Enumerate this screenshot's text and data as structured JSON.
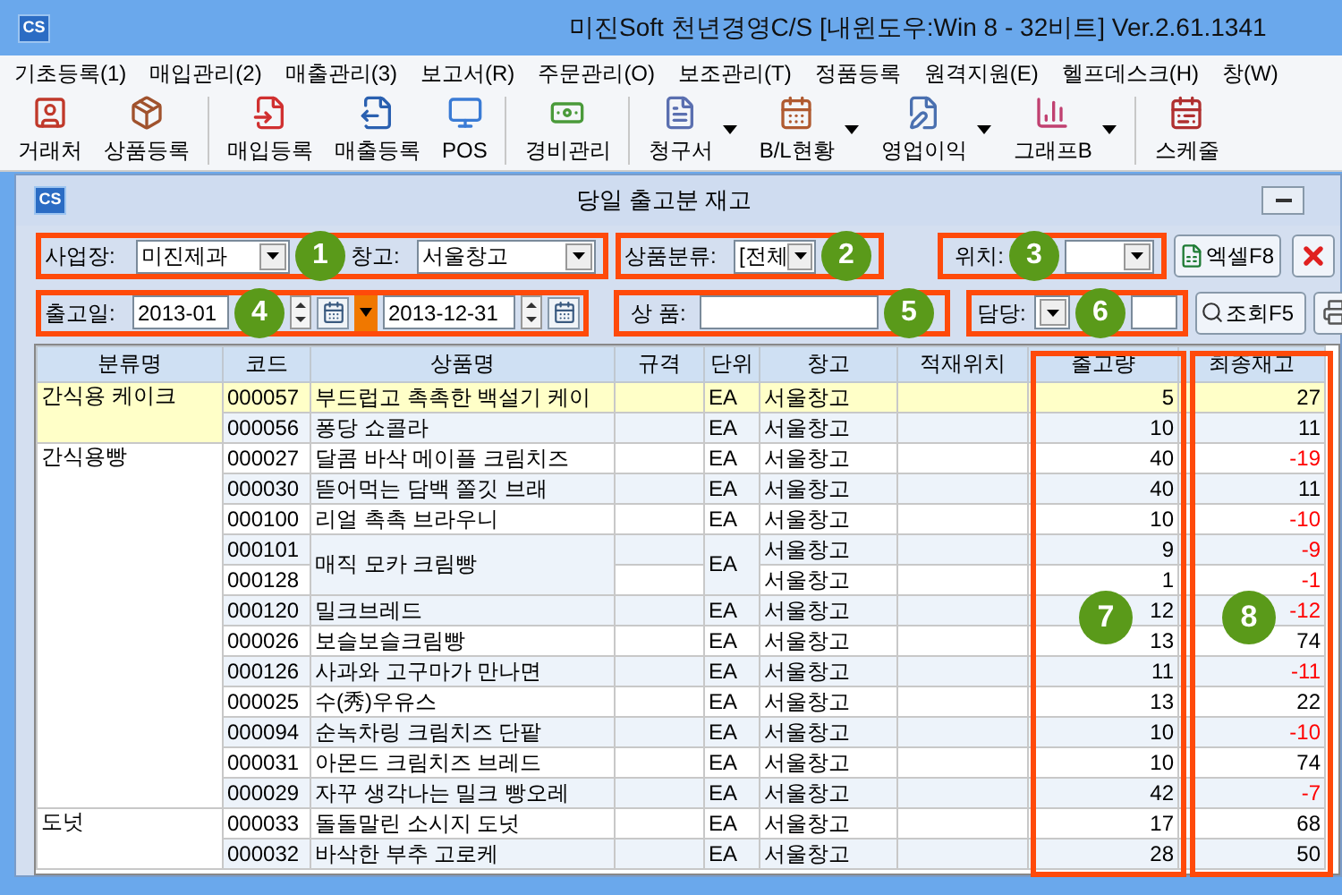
{
  "window": {
    "title": "미진Soft 천년경영C/S [내윈도우:Win 8 - 32비트] Ver.2.61.1341",
    "logo": "CS"
  },
  "menu": [
    "기초등록(1)",
    "매입관리(2)",
    "매출관리(3)",
    "보고서(R)",
    "주문관리(O)",
    "보조관리(T)",
    "정품등록",
    "원격지원(E)",
    "헬프데스크(H)",
    "창(W)"
  ],
  "toolbar": [
    {
      "label": "거래처",
      "kind": "contact",
      "dropdown": false,
      "group_start": false
    },
    {
      "label": "상품등록",
      "kind": "box",
      "dropdown": false,
      "group_start": false
    },
    {
      "label": "매입등록",
      "kind": "in",
      "dropdown": false,
      "group_start": true
    },
    {
      "label": "매출등록",
      "kind": "out",
      "dropdown": false,
      "group_start": false
    },
    {
      "label": "POS",
      "kind": "pos",
      "dropdown": false,
      "group_start": false
    },
    {
      "label": "경비관리",
      "kind": "money",
      "dropdown": false,
      "group_start": true
    },
    {
      "label": "청구서",
      "kind": "invoice",
      "dropdown": true,
      "group_start": true
    },
    {
      "label": "B/L현황",
      "kind": "calendar",
      "dropdown": true,
      "group_start": false
    },
    {
      "label": "영업이익",
      "kind": "edit",
      "dropdown": true,
      "group_start": false
    },
    {
      "label": "그래프B",
      "kind": "chart",
      "dropdown": true,
      "group_start": false
    },
    {
      "label": "스케줄",
      "kind": "schedule",
      "dropdown": false,
      "group_start": true
    }
  ],
  "child_window": {
    "title": "당일 출고분 재고",
    "logo": "CS"
  },
  "filters": {
    "site_label": "사업장:",
    "site_value": "미진제과",
    "warehouse_label": "창고:",
    "warehouse_value": "서울창고",
    "category_label": "상품분류:",
    "category_value": "[전체",
    "location_label": "위치:",
    "excel_button": "엑셀F8",
    "date_label": "출고일:",
    "date_from": "2013-01",
    "date_to": "2013-12-31",
    "product_label": "상 품:",
    "manager_label": "담당:",
    "search_button": "조회F5"
  },
  "annotations": [
    "1",
    "2",
    "3",
    "4",
    "5",
    "6",
    "7",
    "8"
  ],
  "table": {
    "columns": [
      "분류명",
      "코드",
      "상품명",
      "규격",
      "단위",
      "창고",
      "적재위치",
      "출고량",
      "최종재고"
    ],
    "categories": [
      {
        "name": "간식용 케이크",
        "products": [
          {
            "name": "부드럽고 촉촉한 백설기 케이",
            "unit": "EA",
            "lines": [
              {
                "code": "000057",
                "warehouse": "서울창고",
                "qty": "5",
                "stock": "27",
                "negative": false,
                "selected": true
              }
            ]
          },
          {
            "name": "퐁당 쇼콜라",
            "unit": "EA",
            "lines": [
              {
                "code": "000056",
                "warehouse": "서울창고",
                "qty": "10",
                "stock": "11",
                "negative": false,
                "selected": false
              }
            ]
          }
        ]
      },
      {
        "name": "간식용빵",
        "products": [
          {
            "name": "달콤 바삭 메이플 크림치즈",
            "unit": "EA",
            "lines": [
              {
                "code": "000027",
                "warehouse": "서울창고",
                "qty": "40",
                "stock": "-19",
                "negative": true,
                "selected": false
              }
            ]
          },
          {
            "name": "뜯어먹는 담백 쫄깃 브래",
            "unit": "EA",
            "lines": [
              {
                "code": "000030",
                "warehouse": "서울창고",
                "qty": "40",
                "stock": "11",
                "negative": false,
                "selected": false
              }
            ]
          },
          {
            "name": "리얼 촉촉 브라우니",
            "unit": "EA",
            "lines": [
              {
                "code": "000100",
                "warehouse": "서울창고",
                "qty": "10",
                "stock": "-10",
                "negative": true,
                "selected": false
              }
            ]
          },
          {
            "name": "매직 모카 크림빵",
            "unit": "EA",
            "lines": [
              {
                "code": "000101",
                "warehouse": "서울창고",
                "qty": "9",
                "stock": "-9",
                "negative": true,
                "selected": false
              },
              {
                "code": "000128",
                "warehouse": "서울창고",
                "qty": "1",
                "stock": "-1",
                "negative": true,
                "selected": false
              }
            ]
          },
          {
            "name": "밀크브레드",
            "unit": "EA",
            "lines": [
              {
                "code": "000120",
                "warehouse": "서울창고",
                "qty": "12",
                "stock": "-12",
                "negative": true,
                "selected": false
              }
            ]
          },
          {
            "name": "보슬보슬크림빵",
            "unit": "EA",
            "lines": [
              {
                "code": "000026",
                "warehouse": "서울창고",
                "qty": "13",
                "stock": "74",
                "negative": false,
                "selected": false
              }
            ]
          },
          {
            "name": "사과와 고구마가 만나면",
            "unit": "EA",
            "lines": [
              {
                "code": "000126",
                "warehouse": "서울창고",
                "qty": "11",
                "stock": "-11",
                "negative": true,
                "selected": false
              }
            ]
          },
          {
            "name": "수(秀)우유스",
            "unit": "EA",
            "lines": [
              {
                "code": "000025",
                "warehouse": "서울창고",
                "qty": "13",
                "stock": "22",
                "negative": false,
                "selected": false
              }
            ]
          },
          {
            "name": "순녹차링 크림치즈 단팥",
            "unit": "EA",
            "lines": [
              {
                "code": "000094",
                "warehouse": "서울창고",
                "qty": "10",
                "stock": "-10",
                "negative": true,
                "selected": false
              }
            ]
          },
          {
            "name": "아몬드 크림치즈 브레드",
            "unit": "EA",
            "lines": [
              {
                "code": "000031",
                "warehouse": "서울창고",
                "qty": "10",
                "stock": "74",
                "negative": false,
                "selected": false
              }
            ]
          },
          {
            "name": "자꾸 생각나는 밀크 빵오레",
            "unit": "EA",
            "lines": [
              {
                "code": "000029",
                "warehouse": "서울창고",
                "qty": "42",
                "stock": "-7",
                "negative": true,
                "selected": false
              }
            ]
          }
        ]
      },
      {
        "name": "도넛",
        "products": [
          {
            "name": "돌돌말린 소시지 도넛",
            "unit": "EA",
            "lines": [
              {
                "code": "000033",
                "warehouse": "서울창고",
                "qty": "17",
                "stock": "68",
                "negative": false,
                "selected": false
              }
            ]
          },
          {
            "name": "바삭한 부추 고로케",
            "unit": "EA",
            "lines": [
              {
                "code": "000032",
                "warehouse": "서울창고",
                "qty": "28",
                "stock": "50",
                "negative": false,
                "selected": false
              }
            ]
          }
        ]
      }
    ]
  }
}
